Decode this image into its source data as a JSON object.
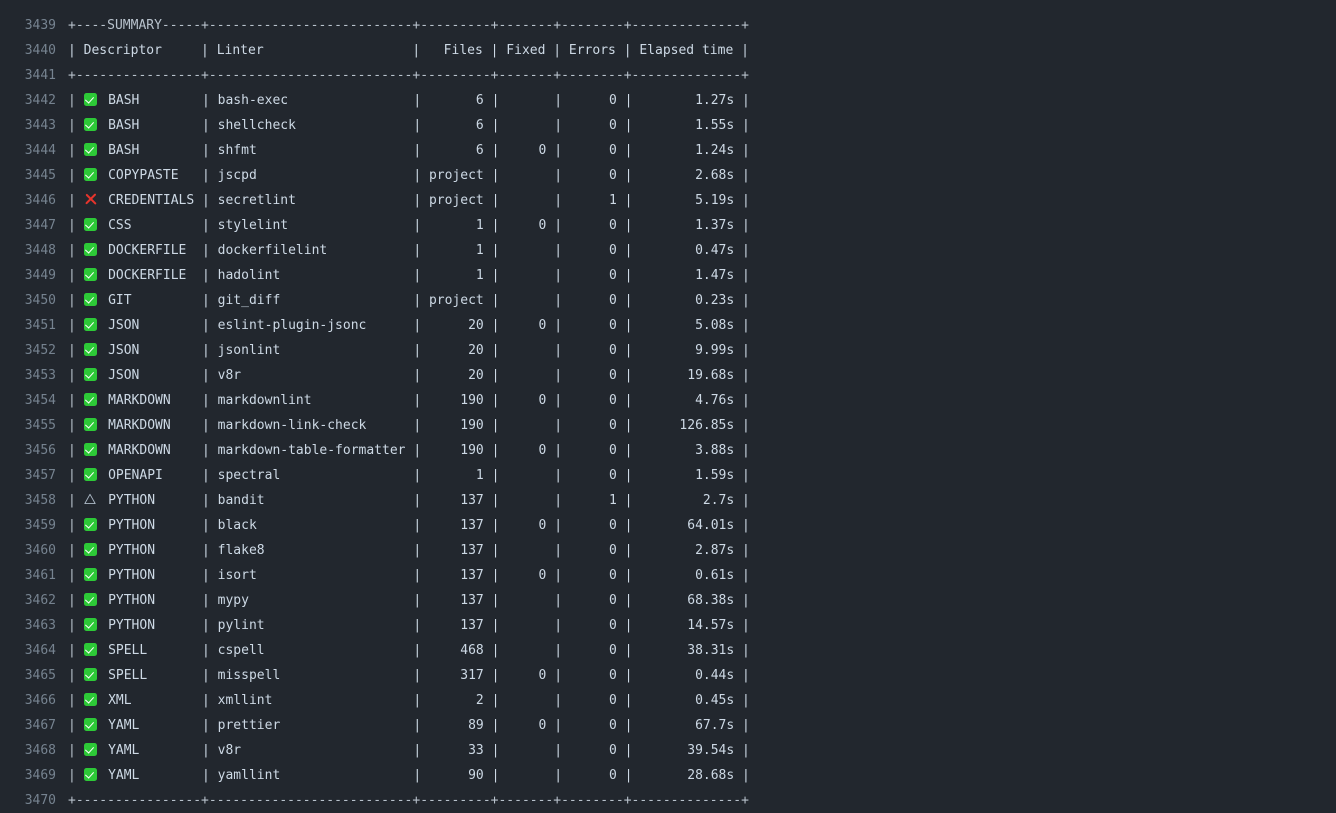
{
  "view": {
    "background": "#22272e",
    "text_color": "#adbac7",
    "line_number_color": "#768390",
    "ok_color": "#2dc937",
    "fail_color": "#e5342c",
    "warn_color": "#adbac7"
  },
  "table": {
    "title": "SUMMARY",
    "top_border": "+----SUMMARY-----+--------------------------+---------+-------+--------+--------------+",
    "header_border": "+----------------+--------------------------+---------+-------+--------+--------------+",
    "bottom_border": "+----------------+--------------------------+---------+-------+--------+--------------+",
    "columns": [
      "Descriptor",
      "Linter",
      "Files",
      "Fixed",
      "Errors",
      "Elapsed time"
    ],
    "first_line_number": 3439
  },
  "lines": [
    {
      "n": 3439,
      "type": "border",
      "text": "+----SUMMARY-----+--------------------------+---------+-------+--------+--------------+"
    },
    {
      "n": 3440,
      "type": "header",
      "descriptor": "Descriptor",
      "linter": "Linter",
      "files": "Files",
      "fixed": "Fixed",
      "errors": "Errors",
      "elapsed": "Elapsed time"
    },
    {
      "n": 3441,
      "type": "border",
      "text": "+----------------+--------------------------+---------+-------+--------+--------------+"
    },
    {
      "n": 3442,
      "type": "data",
      "status": "ok",
      "descriptor": "BASH",
      "linter": "bash-exec",
      "files": "6",
      "fixed": "",
      "errors": "0",
      "elapsed": "1.27s"
    },
    {
      "n": 3443,
      "type": "data",
      "status": "ok",
      "descriptor": "BASH",
      "linter": "shellcheck",
      "files": "6",
      "fixed": "",
      "errors": "0",
      "elapsed": "1.55s"
    },
    {
      "n": 3444,
      "type": "data",
      "status": "ok",
      "descriptor": "BASH",
      "linter": "shfmt",
      "files": "6",
      "fixed": "0",
      "errors": "0",
      "elapsed": "1.24s"
    },
    {
      "n": 3445,
      "type": "data",
      "status": "ok",
      "descriptor": "COPYPASTE",
      "linter": "jscpd",
      "files": "project",
      "fixed": "",
      "errors": "0",
      "elapsed": "2.68s"
    },
    {
      "n": 3446,
      "type": "data",
      "status": "fail",
      "descriptor": "CREDENTIALS",
      "linter": "secretlint",
      "files": "project",
      "fixed": "",
      "errors": "1",
      "elapsed": "5.19s"
    },
    {
      "n": 3447,
      "type": "data",
      "status": "ok",
      "descriptor": "CSS",
      "linter": "stylelint",
      "files": "1",
      "fixed": "0",
      "errors": "0",
      "elapsed": "1.37s"
    },
    {
      "n": 3448,
      "type": "data",
      "status": "ok",
      "descriptor": "DOCKERFILE",
      "linter": "dockerfilelint",
      "files": "1",
      "fixed": "",
      "errors": "0",
      "elapsed": "0.47s"
    },
    {
      "n": 3449,
      "type": "data",
      "status": "ok",
      "descriptor": "DOCKERFILE",
      "linter": "hadolint",
      "files": "1",
      "fixed": "",
      "errors": "0",
      "elapsed": "1.47s"
    },
    {
      "n": 3450,
      "type": "data",
      "status": "ok",
      "descriptor": "GIT",
      "linter": "git_diff",
      "files": "project",
      "fixed": "",
      "errors": "0",
      "elapsed": "0.23s"
    },
    {
      "n": 3451,
      "type": "data",
      "status": "ok",
      "descriptor": "JSON",
      "linter": "eslint-plugin-jsonc",
      "files": "20",
      "fixed": "0",
      "errors": "0",
      "elapsed": "5.08s"
    },
    {
      "n": 3452,
      "type": "data",
      "status": "ok",
      "descriptor": "JSON",
      "linter": "jsonlint",
      "files": "20",
      "fixed": "",
      "errors": "0",
      "elapsed": "9.99s"
    },
    {
      "n": 3453,
      "type": "data",
      "status": "ok",
      "descriptor": "JSON",
      "linter": "v8r",
      "files": "20",
      "fixed": "",
      "errors": "0",
      "elapsed": "19.68s"
    },
    {
      "n": 3454,
      "type": "data",
      "status": "ok",
      "descriptor": "MARKDOWN",
      "linter": "markdownlint",
      "files": "190",
      "fixed": "0",
      "errors": "0",
      "elapsed": "4.76s"
    },
    {
      "n": 3455,
      "type": "data",
      "status": "ok",
      "descriptor": "MARKDOWN",
      "linter": "markdown-link-check",
      "files": "190",
      "fixed": "",
      "errors": "0",
      "elapsed": "126.85s"
    },
    {
      "n": 3456,
      "type": "data",
      "status": "ok",
      "descriptor": "MARKDOWN",
      "linter": "markdown-table-formatter",
      "files": "190",
      "fixed": "0",
      "errors": "0",
      "elapsed": "3.88s"
    },
    {
      "n": 3457,
      "type": "data",
      "status": "ok",
      "descriptor": "OPENAPI",
      "linter": "spectral",
      "files": "1",
      "fixed": "",
      "errors": "0",
      "elapsed": "1.59s"
    },
    {
      "n": 3458,
      "type": "data",
      "status": "warn",
      "descriptor": "PYTHON",
      "linter": "bandit",
      "files": "137",
      "fixed": "",
      "errors": "1",
      "elapsed": "2.7s"
    },
    {
      "n": 3459,
      "type": "data",
      "status": "ok",
      "descriptor": "PYTHON",
      "linter": "black",
      "files": "137",
      "fixed": "0",
      "errors": "0",
      "elapsed": "64.01s"
    },
    {
      "n": 3460,
      "type": "data",
      "status": "ok",
      "descriptor": "PYTHON",
      "linter": "flake8",
      "files": "137",
      "fixed": "",
      "errors": "0",
      "elapsed": "2.87s"
    },
    {
      "n": 3461,
      "type": "data",
      "status": "ok",
      "descriptor": "PYTHON",
      "linter": "isort",
      "files": "137",
      "fixed": "0",
      "errors": "0",
      "elapsed": "0.61s"
    },
    {
      "n": 3462,
      "type": "data",
      "status": "ok",
      "descriptor": "PYTHON",
      "linter": "mypy",
      "files": "137",
      "fixed": "",
      "errors": "0",
      "elapsed": "68.38s"
    },
    {
      "n": 3463,
      "type": "data",
      "status": "ok",
      "descriptor": "PYTHON",
      "linter": "pylint",
      "files": "137",
      "fixed": "",
      "errors": "0",
      "elapsed": "14.57s"
    },
    {
      "n": 3464,
      "type": "data",
      "status": "ok",
      "descriptor": "SPELL",
      "linter": "cspell",
      "files": "468",
      "fixed": "",
      "errors": "0",
      "elapsed": "38.31s"
    },
    {
      "n": 3465,
      "type": "data",
      "status": "ok",
      "descriptor": "SPELL",
      "linter": "misspell",
      "files": "317",
      "fixed": "0",
      "errors": "0",
      "elapsed": "0.44s"
    },
    {
      "n": 3466,
      "type": "data",
      "status": "ok",
      "descriptor": "XML",
      "linter": "xmllint",
      "files": "2",
      "fixed": "",
      "errors": "0",
      "elapsed": "0.45s"
    },
    {
      "n": 3467,
      "type": "data",
      "status": "ok",
      "descriptor": "YAML",
      "linter": "prettier",
      "files": "89",
      "fixed": "0",
      "errors": "0",
      "elapsed": "67.7s"
    },
    {
      "n": 3468,
      "type": "data",
      "status": "ok",
      "descriptor": "YAML",
      "linter": "v8r",
      "files": "33",
      "fixed": "",
      "errors": "0",
      "elapsed": "39.54s"
    },
    {
      "n": 3469,
      "type": "data",
      "status": "ok",
      "descriptor": "YAML",
      "linter": "yamllint",
      "files": "90",
      "fixed": "",
      "errors": "0",
      "elapsed": "28.68s"
    },
    {
      "n": 3470,
      "type": "border",
      "text": "+----------------+--------------------------+---------+-------+--------+--------------+"
    }
  ]
}
